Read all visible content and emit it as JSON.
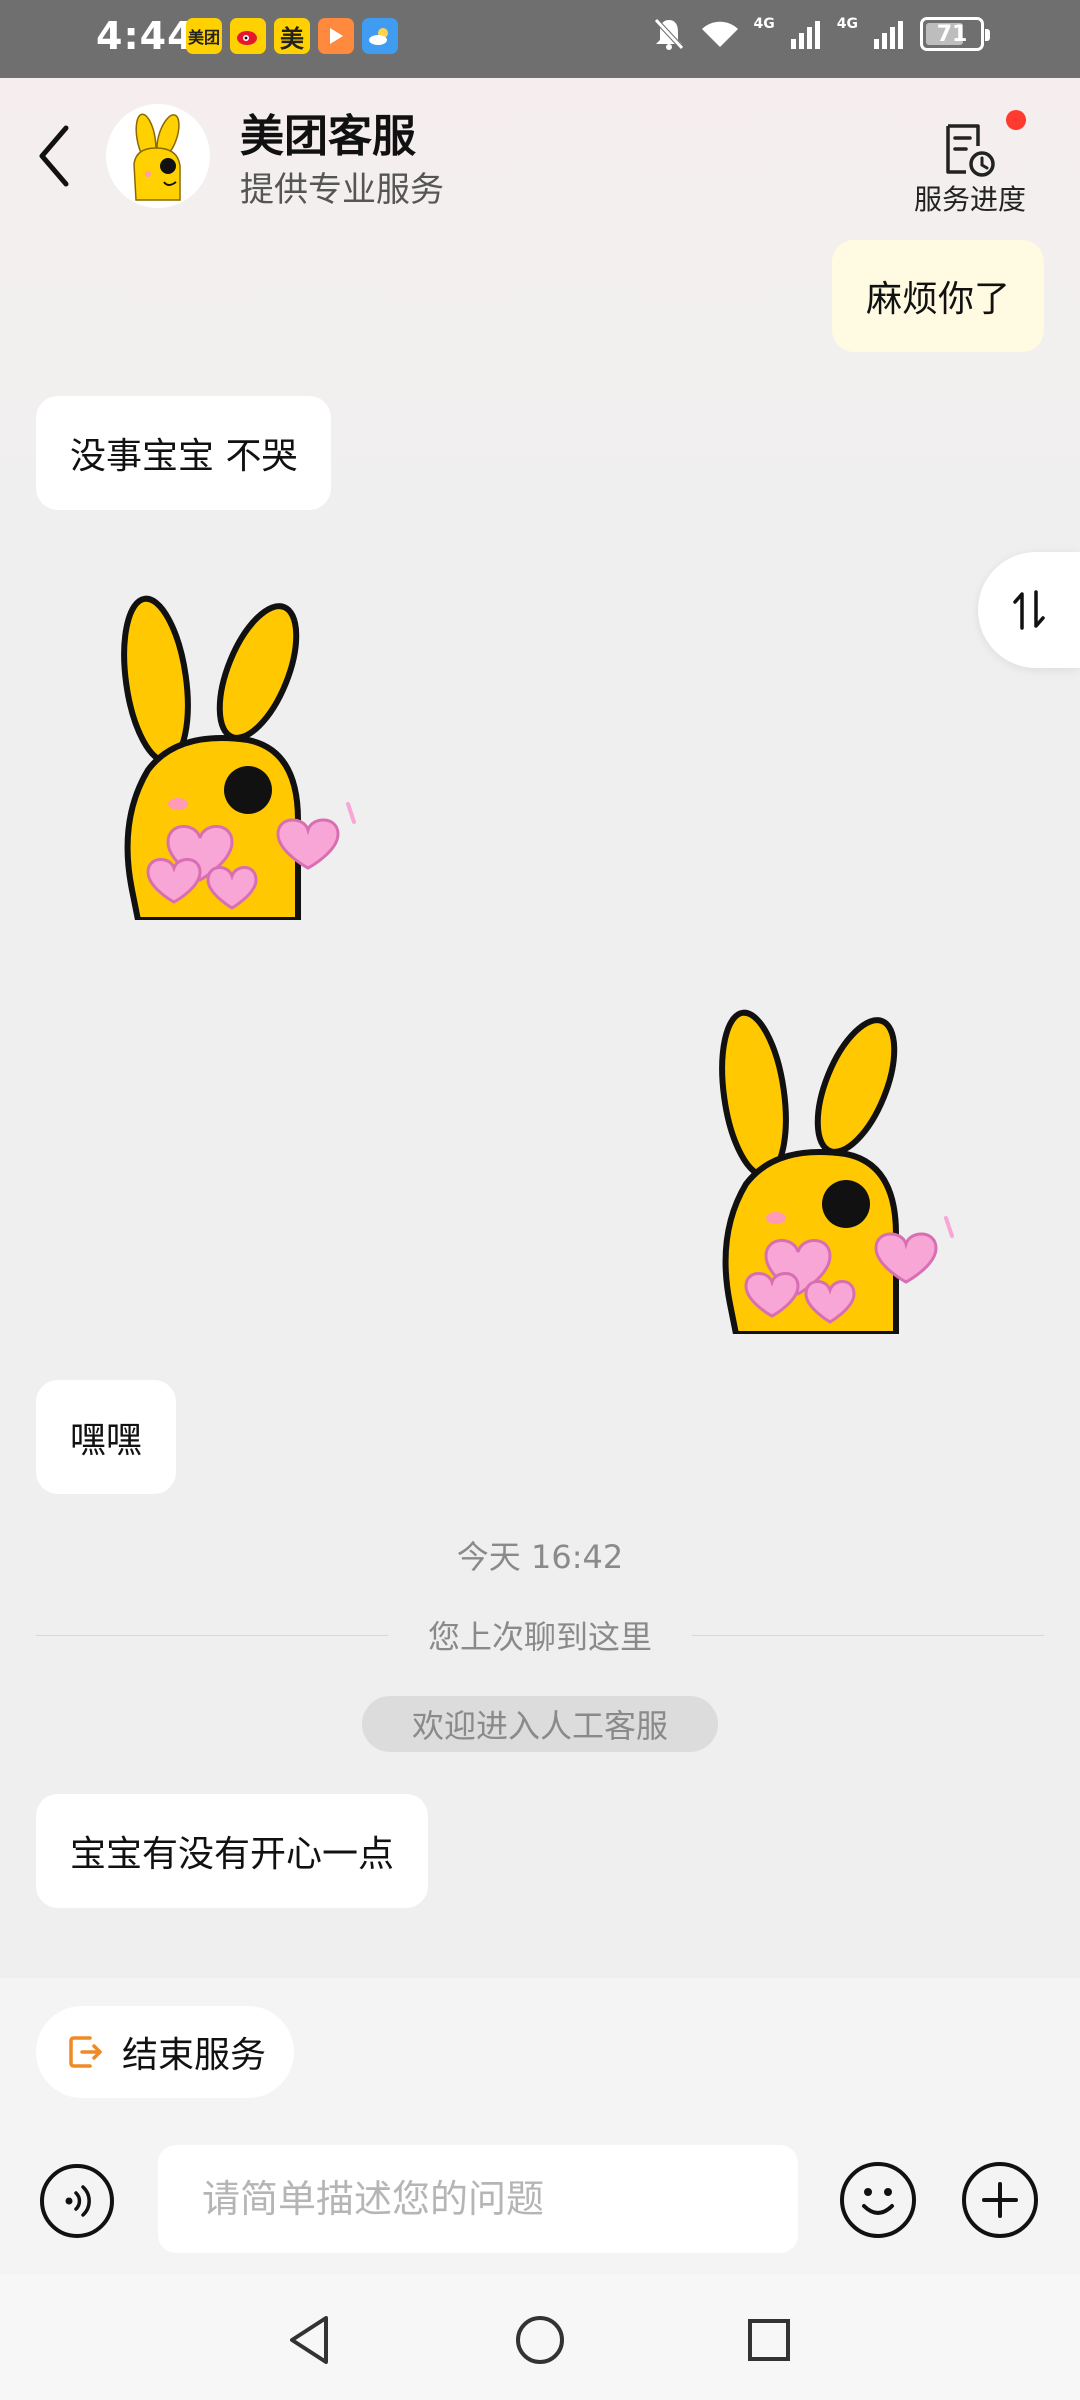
{
  "status_bar": {
    "time": "4:44",
    "apps": [
      {
        "icon": "meituan-app-icon",
        "label": "美团",
        "color": "#ffd100"
      },
      {
        "icon": "weibo-app-icon",
        "label": "",
        "color": "#ffd100"
      },
      {
        "icon": "meituan-shop-app-icon",
        "label": "美",
        "color": "#ffd100"
      },
      {
        "icon": "video-app-icon",
        "label": "",
        "color": "#ff8a3d"
      },
      {
        "icon": "weather-app-icon",
        "label": "",
        "color": "#3f9cf0"
      }
    ],
    "network_1": "4G",
    "network_2": "4G",
    "battery": "71",
    "battery_level": 0.71
  },
  "header": {
    "title": "美团客服",
    "subtitle": "提供专业服务",
    "progress_label": "服务进度"
  },
  "messages": [
    {
      "side": "right",
      "type": "text",
      "text": "麻烦你了"
    },
    {
      "side": "left",
      "type": "text",
      "text": "没事宝宝 不哭"
    },
    {
      "side": "left",
      "type": "sticker",
      "sticker": "yellow-rabbit-hearts-sticker"
    },
    {
      "side": "right",
      "type": "sticker",
      "sticker": "yellow-rabbit-hearts-sticker"
    },
    {
      "side": "left",
      "type": "text",
      "text": "嘿嘿"
    },
    {
      "side": "left",
      "type": "text",
      "text": "宝宝有没有开心一点"
    }
  ],
  "separators": {
    "time": "今天 16:42",
    "history": "您上次聊到这里",
    "welcome": "欢迎进入人工客服"
  },
  "bottom": {
    "end_service_label": "结束服务",
    "input_placeholder": "请简单描述您的问题",
    "input_value": ""
  },
  "colors": {
    "brand_yellow": "#ffd100",
    "accent_orange": "#f08a24",
    "notification_red": "#ff3b30",
    "user_bubble": "#fffbe3"
  }
}
